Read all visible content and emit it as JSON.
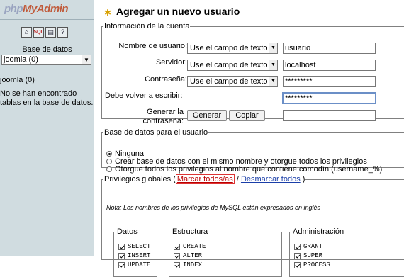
{
  "nav": {
    "logo_php": "php",
    "logo_my": "My",
    "logo_admin": "Admin",
    "icons": [
      "home-icon",
      "sql-icon",
      "query-icon",
      "docs-icon"
    ],
    "db_label": "Base de datos",
    "db_selected": "joomla (0)",
    "db_name": "joomla (0)",
    "db_empty_msg": "No se han encontrado tablas en la base de datos."
  },
  "main": {
    "title": "Agregar un nuevo usuario",
    "account": {
      "legend": "Información de la cuenta",
      "username_label": "Nombre de usuario:",
      "username_mode": "Use el campo de texto",
      "username_value": "usuario",
      "host_label": "Servidor:",
      "host_mode": "Use el campo de texto",
      "host_value": "localhost",
      "password_label": "Contraseña:",
      "password_mode": "Use el campo de texto",
      "password_value": "*********",
      "retype_label": "Debe volver a escribir:",
      "retype_value": "*********",
      "generate_label_1": "Generar la",
      "generate_label_2": "contraseña:",
      "generate_button": "Generar",
      "copy_button": "Copiar",
      "generated_value": ""
    },
    "database": {
      "legend": "Base de datos para el usuario",
      "options": [
        "Ninguna",
        "Crear base de datos con el mismo nombre y otorgue todos los privilegios",
        "Otorgue todos los privilegios al nombre que contiene comodín (username_%)"
      ],
      "selected_index": 0
    },
    "privileges": {
      "legend_prefix": "Privilegios globales (",
      "check_all": "Marcar todos/as",
      "separator": " / ",
      "uncheck_all": "Desmarcar todos",
      "legend_suffix": " )",
      "note": "Nota: Los nombres de los privilegios de MySQL están expresados en inglés",
      "groups": [
        {
          "legend": "Datos",
          "items": [
            "SELECT",
            "INSERT",
            "UPDATE"
          ]
        },
        {
          "legend": "Estructura",
          "items": [
            "CREATE",
            "ALTER",
            "INDEX"
          ]
        },
        {
          "legend": "Administración",
          "items": [
            "GRANT",
            "SUPER",
            "PROCESS"
          ]
        }
      ]
    }
  }
}
